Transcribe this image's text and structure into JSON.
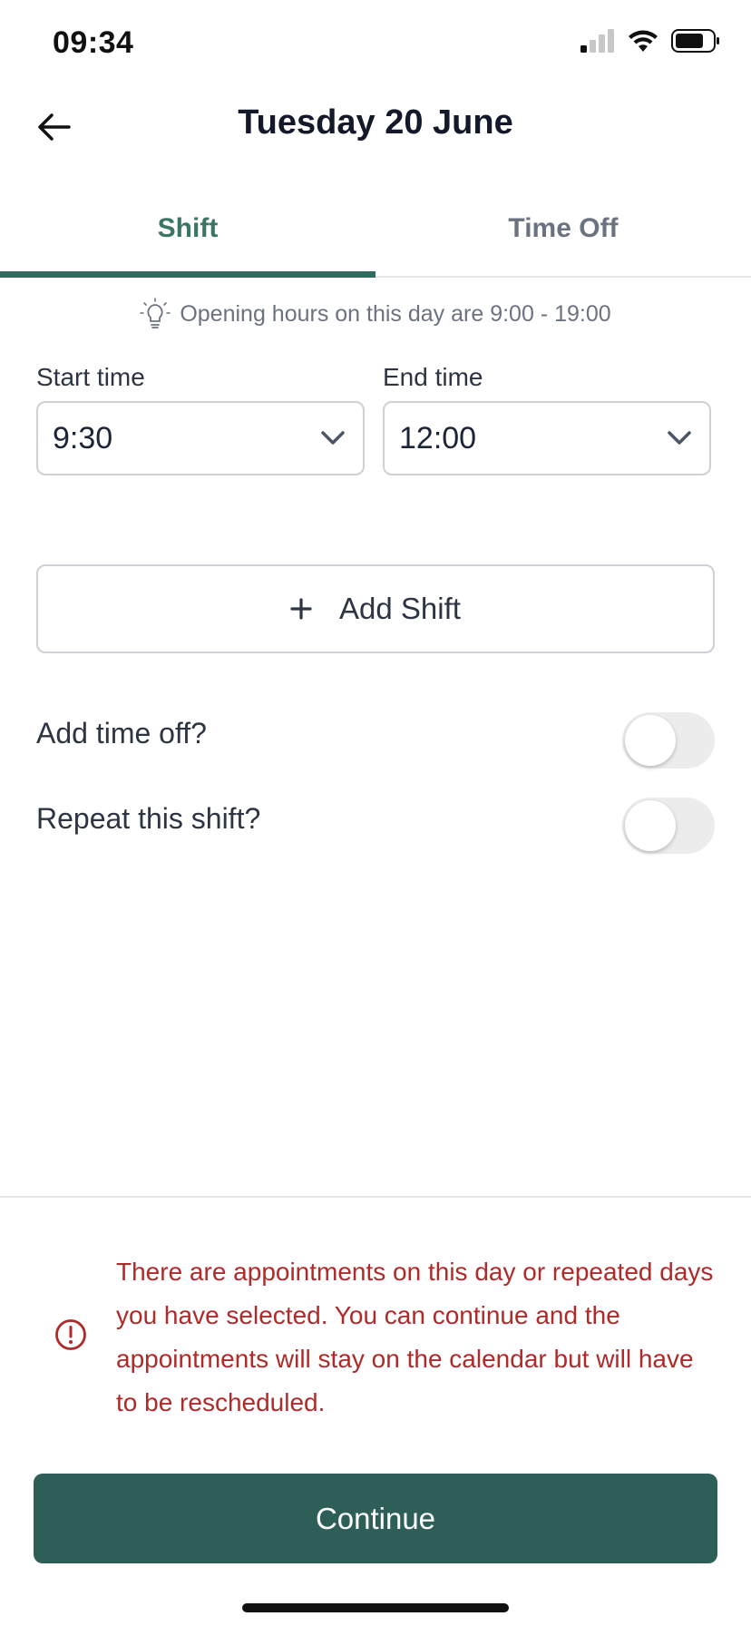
{
  "status_bar": {
    "time": "09:34",
    "signal_icon": "cellular-signal-icon",
    "wifi_icon": "wifi-icon",
    "battery_icon": "battery-icon"
  },
  "header": {
    "back_icon": "arrow-left-icon",
    "title": "Tuesday 20 June"
  },
  "tabs": [
    {
      "label": "Shift",
      "active": true
    },
    {
      "label": "Time Off",
      "active": false
    }
  ],
  "hint": {
    "icon": "lightbulb-icon",
    "text": "Opening hours on this day are 9:00 - 19:00"
  },
  "start_time": {
    "label": "Start time",
    "value": "9:30"
  },
  "end_time": {
    "label": "End time",
    "value": "12:00"
  },
  "add_shift": {
    "icon": "plus-icon",
    "label": "Add Shift"
  },
  "toggles": {
    "time_off": {
      "label": "Add time off?",
      "on": false
    },
    "repeat": {
      "label": "Repeat this shift?",
      "on": false
    }
  },
  "warning": {
    "icon": "alert-circle-icon",
    "text": "There are appointments on this day or repeated days you have selected. You can continue and the appointments will stay on the calendar but will have to be rescheduled."
  },
  "continue_label": "Continue",
  "colors": {
    "accent": "#2f6b5f",
    "accent_text": "#3b7566",
    "button": "#2d5f58",
    "error": "#b02a2a"
  }
}
